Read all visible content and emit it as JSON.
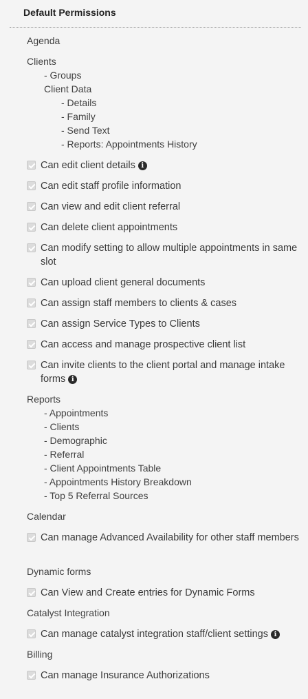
{
  "title": "Default Permissions",
  "info_glyph": "i",
  "sections": {
    "agenda": "Agenda",
    "clients": {
      "label": "Clients",
      "groups": "- Groups",
      "client_data": "Client Data",
      "details": "- Details",
      "family": "- Family",
      "send_text": "- Send Text",
      "reports_appointments_history": "- Reports: Appointments History",
      "permissions": [
        "Can edit client details",
        "Can edit staff profile information",
        "Can view and edit client referral",
        "Can delete client appointments",
        "Can modify setting to allow multiple appointments in same slot",
        "Can upload client general documents",
        "Can assign staff members to clients & cases",
        "Can assign Service Types to Clients",
        "Can access and manage prospective client list",
        "Can invite clients to the client portal and manage intake forms"
      ]
    },
    "reports": {
      "label": "Reports",
      "items": [
        "- Appointments",
        "- Clients",
        "- Demographic",
        "- Referral",
        "- Client Appointments Table",
        "- Appointments History Breakdown",
        "- Top 5 Referral Sources"
      ]
    },
    "calendar": {
      "label": "Calendar",
      "permission": "Can manage Advanced Availability for other staff members"
    },
    "dynamic_forms": {
      "label": "Dynamic forms",
      "permission": "Can View and Create entries for Dynamic Forms"
    },
    "catalyst": {
      "label": "Catalyst Integration",
      "permission": "Can manage catalyst integration staff/client settings"
    },
    "billing": {
      "label": "Billing",
      "permission": "Can manage Insurance Authorizations"
    }
  }
}
